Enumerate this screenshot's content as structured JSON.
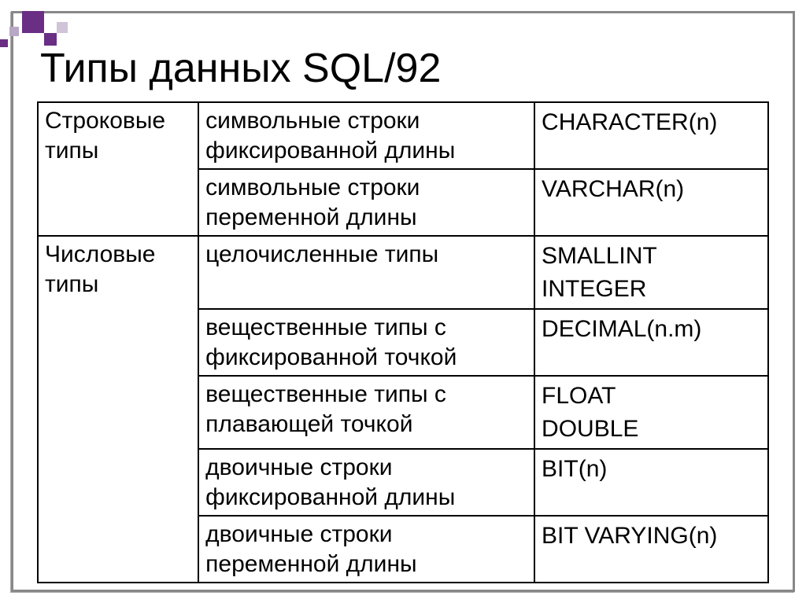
{
  "title": "Типы данных SQL/92",
  "rows": [
    {
      "cat": "Строковые типы",
      "desc": "символьные строки фиксированной длины",
      "vals": [
        "CHARACTER(n)"
      ],
      "rowspan": 2
    },
    {
      "cat": "",
      "desc": "символьные строки переменной длины",
      "vals": [
        "VARCHAR(n)"
      ]
    },
    {
      "cat": "Числовые типы",
      "desc": "целочисленные типы",
      "vals": [
        "SMALLINT",
        "INTEGER"
      ],
      "rowspan": 5
    },
    {
      "cat": "",
      "desc": "вещественные типы с фиксированной точкой",
      "vals": [
        "DECIMAL(n.m)"
      ]
    },
    {
      "cat": "",
      "desc": "вещественные типы с плавающей точкой",
      "vals": [
        "FLOAT",
        "DOUBLE"
      ]
    },
    {
      "cat": "",
      "desc": "двоичные строки фиксированной длины",
      "vals": [
        "BIT(n)"
      ]
    },
    {
      "cat": "",
      "desc": "двоичные строки переменной длины",
      "vals": [
        "BIT VARYING(n)"
      ]
    }
  ]
}
